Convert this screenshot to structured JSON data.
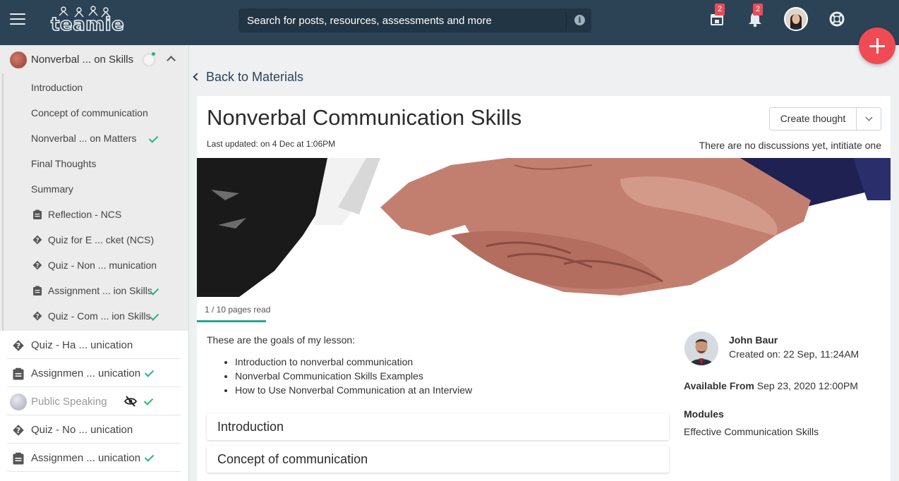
{
  "app": {
    "logo_text": "teamie",
    "search_placeholder": "Search for posts, resources, assessments and more",
    "schedule_badge": "2",
    "notifications_badge": "2",
    "accent_color": "#f04b55",
    "topbar_color": "#2c4356"
  },
  "sidebar": {
    "group": {
      "title": "Nonverbal ... on Skills",
      "items": [
        {
          "label": "Introduction",
          "icon": "",
          "done": false
        },
        {
          "label": "Concept of communication",
          "icon": "",
          "done": false
        },
        {
          "label": "Nonverbal ... on Matters",
          "icon": "",
          "done": true
        },
        {
          "label": "Final Thoughts",
          "icon": "",
          "done": false
        },
        {
          "label": "Summary",
          "icon": "",
          "done": false
        },
        {
          "label": "Reflection - NCS",
          "icon": "clipboard-icon",
          "done": false
        },
        {
          "label": "Quiz for E ... cket (NCS)",
          "icon": "quiz-icon",
          "done": false
        },
        {
          "label": "Quiz - Non ... munication",
          "icon": "quiz-icon",
          "done": false
        },
        {
          "label": "Assignment ... ion Skills",
          "icon": "clipboard-icon",
          "done": true
        },
        {
          "label": "Quiz - Com ... ion Skills",
          "icon": "quiz-icon",
          "done": true
        }
      ]
    },
    "items": [
      {
        "label": "Quiz - Ha ... unication",
        "icon": "quiz-icon",
        "done": false
      },
      {
        "label": "Assignmen ... unication",
        "icon": "clipboard-icon",
        "done": true
      },
      {
        "label": "Public Speaking",
        "icon": "thumbnail",
        "hidden": true,
        "done": true
      },
      {
        "label": "Quiz - No ... unication",
        "icon": "quiz-icon",
        "done": false
      },
      {
        "label": "Assignmen ... unication",
        "icon": "clipboard-icon",
        "done": true
      }
    ]
  },
  "main": {
    "back_label": "Back to Materials",
    "title": "Nonverbal Communication Skills",
    "last_updated": "Last updated: on 4 Dec at 1:06PM",
    "create_thought_label": "Create thought",
    "no_discussions": "There are no discussions yet, intitiate one",
    "pages_read": "1 / 10 pages read",
    "pages_read_fraction": 0.1,
    "goals_intro": "These are the goals of my lesson:",
    "goals": [
      "Introduction to nonverbal communication",
      "Nonverbal Communication Skills Examples",
      "How to Use Nonverbal Communication at an Interview"
    ],
    "sections": [
      "Introduction",
      "Concept of communication"
    ],
    "author": {
      "name": "John Baur",
      "created": "Created on: 22 Sep, 11:24AM"
    },
    "available_label": "Available From",
    "available_value": "Sep 23, 2020 12:00PM",
    "modules_label": "Modules",
    "modules_value": "Effective Communication Skills"
  }
}
